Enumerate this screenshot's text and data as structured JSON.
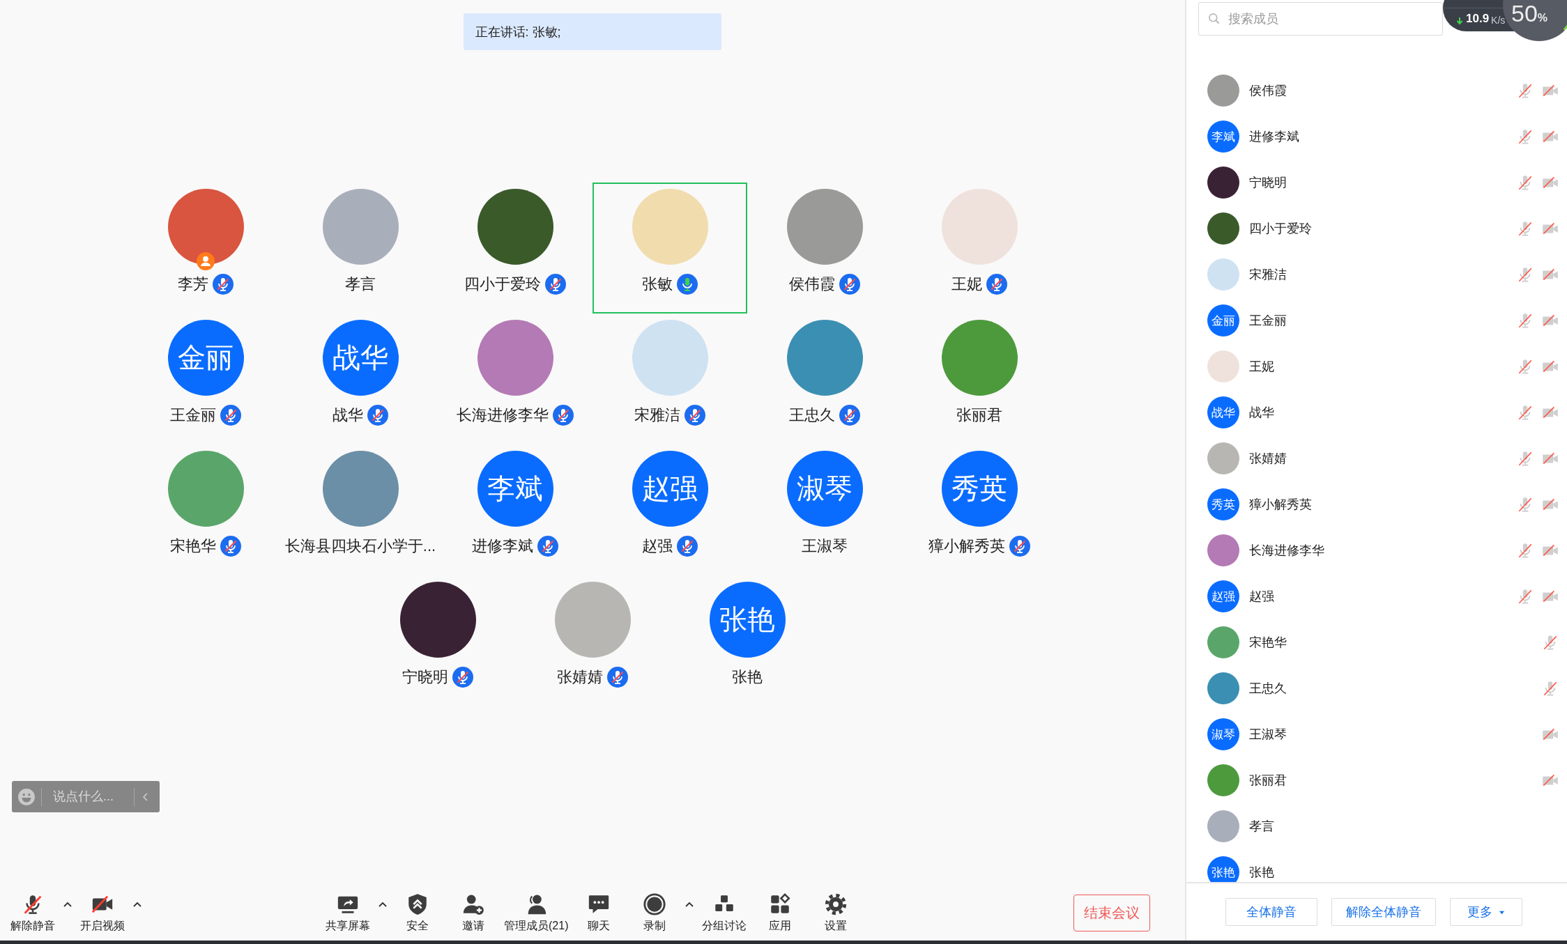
{
  "speaking_banner": {
    "label": "正在讲话: 张敏;"
  },
  "tiles": [
    {
      "name": "李芳",
      "avatar": {
        "kind": "photo",
        "color": "#d9553f"
      },
      "host": true,
      "mic_muted": true,
      "speaking": false,
      "selected": false
    },
    {
      "name": "孝言",
      "avatar": {
        "kind": "photo",
        "color": "#a9aebb"
      },
      "host": false,
      "mic_muted": false,
      "speaking": false,
      "selected": false
    },
    {
      "name": "四小于爱玲",
      "avatar": {
        "kind": "photo",
        "color": "#3a5a2a"
      },
      "host": false,
      "mic_muted": true,
      "speaking": false,
      "selected": false
    },
    {
      "name": "张敏",
      "avatar": {
        "kind": "photo",
        "color": "#f1dcae"
      },
      "host": false,
      "mic_muted": false,
      "speaking": true,
      "selected": true
    },
    {
      "name": "侯伟霞",
      "avatar": {
        "kind": "photo",
        "color": "#9a9a98"
      },
      "host": false,
      "mic_muted": true,
      "speaking": false,
      "selected": false
    },
    {
      "name": "王妮",
      "avatar": {
        "kind": "photo",
        "color": "#efe2dc"
      },
      "host": false,
      "mic_muted": true,
      "speaking": false,
      "selected": false
    },
    {
      "name": "王金丽",
      "avatar": {
        "kind": "text",
        "text": "金丽"
      },
      "host": false,
      "mic_muted": true,
      "speaking": false,
      "selected": false
    },
    {
      "name": "战华",
      "avatar": {
        "kind": "text",
        "text": "战华"
      },
      "host": false,
      "mic_muted": true,
      "speaking": false,
      "selected": false
    },
    {
      "name": "长海进修李华",
      "avatar": {
        "kind": "photo",
        "color": "#b47ab5"
      },
      "host": false,
      "mic_muted": true,
      "speaking": false,
      "selected": false
    },
    {
      "name": "宋雅洁",
      "avatar": {
        "kind": "photo",
        "color": "#cfe2f2"
      },
      "host": false,
      "mic_muted": true,
      "speaking": false,
      "selected": false
    },
    {
      "name": "王忠久",
      "avatar": {
        "kind": "photo",
        "color": "#3b8fb3"
      },
      "host": false,
      "mic_muted": true,
      "speaking": false,
      "selected": false
    },
    {
      "name": "张丽君",
      "avatar": {
        "kind": "photo",
        "color": "#4d9a3d"
      },
      "host": false,
      "mic_muted": false,
      "speaking": false,
      "selected": false
    },
    {
      "name": "宋艳华",
      "avatar": {
        "kind": "photo",
        "color": "#5aa66a"
      },
      "host": false,
      "mic_muted": true,
      "speaking": false,
      "selected": false
    },
    {
      "name": "长海县四块石小学于...",
      "avatar": {
        "kind": "photo",
        "color": "#6c8fa8"
      },
      "host": false,
      "mic_muted": false,
      "speaking": false,
      "selected": false
    },
    {
      "name": "进修李斌",
      "avatar": {
        "kind": "text",
        "text": "李斌"
      },
      "host": false,
      "mic_muted": true,
      "speaking": false,
      "selected": false
    },
    {
      "name": "赵强",
      "avatar": {
        "kind": "text",
        "text": "赵强"
      },
      "host": false,
      "mic_muted": true,
      "speaking": false,
      "selected": false
    },
    {
      "name": "王淑琴",
      "avatar": {
        "kind": "text",
        "text": "淑琴"
      },
      "host": false,
      "mic_muted": false,
      "speaking": false,
      "selected": false
    },
    {
      "name": "獐小解秀英",
      "avatar": {
        "kind": "text",
        "text": "秀英"
      },
      "host": false,
      "mic_muted": true,
      "speaking": false,
      "selected": false
    },
    {
      "name": "宁晓明",
      "avatar": {
        "kind": "photo",
        "color": "#3a2235"
      },
      "host": false,
      "mic_muted": true,
      "speaking": false,
      "selected": false
    },
    {
      "name": "张婧婧",
      "avatar": {
        "kind": "photo",
        "color": "#b8b6b3"
      },
      "host": false,
      "mic_muted": true,
      "speaking": false,
      "selected": false
    },
    {
      "name": "张艳",
      "avatar": {
        "kind": "text",
        "text": "张艳"
      },
      "host": false,
      "mic_muted": false,
      "speaking": false,
      "selected": false
    }
  ],
  "chat": {
    "placeholder": "说点什么..."
  },
  "toolbar": {
    "left": [
      {
        "kind": "button",
        "label": "解除静音"
      },
      {
        "kind": "caret"
      },
      {
        "kind": "button",
        "label": "开启视频"
      },
      {
        "kind": "caret"
      }
    ],
    "center": [
      {
        "kind": "button",
        "label": "共享屏幕"
      },
      {
        "kind": "caret"
      },
      {
        "kind": "button",
        "label": "安全"
      },
      {
        "kind": "button",
        "label": "邀请"
      },
      {
        "kind": "button",
        "label": "管理成员(21)"
      },
      {
        "kind": "button",
        "label": "聊天"
      },
      {
        "kind": "button",
        "label": "录制"
      },
      {
        "kind": "caret"
      },
      {
        "kind": "button",
        "label": "分组讨论"
      },
      {
        "kind": "button",
        "label": "应用"
      },
      {
        "kind": "button",
        "label": "设置"
      }
    ],
    "end_button": "结束会议"
  },
  "members": {
    "search": {
      "placeholder": "搜索成员"
    },
    "rows": [
      {
        "name": "侯伟霞",
        "avatar": {
          "kind": "photo",
          "color": "#9a9a98"
        },
        "mic_muted": true,
        "camera_off": true
      },
      {
        "name": "进修李斌",
        "avatar": {
          "kind": "text",
          "text": "李斌"
        },
        "mic_muted": true,
        "camera_off": true
      },
      {
        "name": "宁晓明",
        "avatar": {
          "kind": "photo",
          "color": "#3a2235"
        },
        "mic_muted": true,
        "camera_off": true
      },
      {
        "name": "四小于爱玲",
        "avatar": {
          "kind": "photo",
          "color": "#3a5a2a"
        },
        "mic_muted": true,
        "camera_off": true
      },
      {
        "name": "宋雅洁",
        "avatar": {
          "kind": "photo",
          "color": "#cfe2f2"
        },
        "mic_muted": true,
        "camera_off": true
      },
      {
        "name": "王金丽",
        "avatar": {
          "kind": "text",
          "text": "金丽"
        },
        "mic_muted": true,
        "camera_off": true
      },
      {
        "name": "王妮",
        "avatar": {
          "kind": "photo",
          "color": "#efe2dc"
        },
        "mic_muted": true,
        "camera_off": true
      },
      {
        "name": "战华",
        "avatar": {
          "kind": "text",
          "text": "战华"
        },
        "mic_muted": true,
        "camera_off": true
      },
      {
        "name": "张婧婧",
        "avatar": {
          "kind": "photo",
          "color": "#b8b6b3"
        },
        "mic_muted": true,
        "camera_off": true
      },
      {
        "name": "獐小解秀英",
        "avatar": {
          "kind": "text",
          "text": "秀英"
        },
        "mic_muted": true,
        "camera_off": true
      },
      {
        "name": "长海进修李华",
        "avatar": {
          "kind": "photo",
          "color": "#b47ab5"
        },
        "mic_muted": true,
        "camera_off": true
      },
      {
        "name": "赵强",
        "avatar": {
          "kind": "text",
          "text": "赵强"
        },
        "mic_muted": true,
        "camera_off": true
      },
      {
        "name": "宋艳华",
        "avatar": {
          "kind": "photo",
          "color": "#5aa66a"
        },
        "mic_muted": true,
        "camera_off": false
      },
      {
        "name": "王忠久",
        "avatar": {
          "kind": "photo",
          "color": "#3b8fb3"
        },
        "mic_muted": true,
        "camera_off": false
      },
      {
        "name": "王淑琴",
        "avatar": {
          "kind": "text",
          "text": "淑琴"
        },
        "mic_muted": false,
        "camera_off": true
      },
      {
        "name": "张丽君",
        "avatar": {
          "kind": "photo",
          "color": "#4d9a3d"
        },
        "mic_muted": false,
        "camera_off": true
      },
      {
        "name": "孝言",
        "avatar": {
          "kind": "photo",
          "color": "#a9aebb"
        },
        "mic_muted": false,
        "camera_off": false
      },
      {
        "name": "张艳",
        "avatar": {
          "kind": "text",
          "text": "张艳"
        },
        "mic_muted": false,
        "camera_off": false
      }
    ],
    "footer_buttons": [
      "全体静音",
      "解除全体静音",
      "更多"
    ]
  },
  "network": {
    "download": "10.9",
    "download_unit": "K/s",
    "cpu": "50",
    "cpu_unit": "%"
  }
}
